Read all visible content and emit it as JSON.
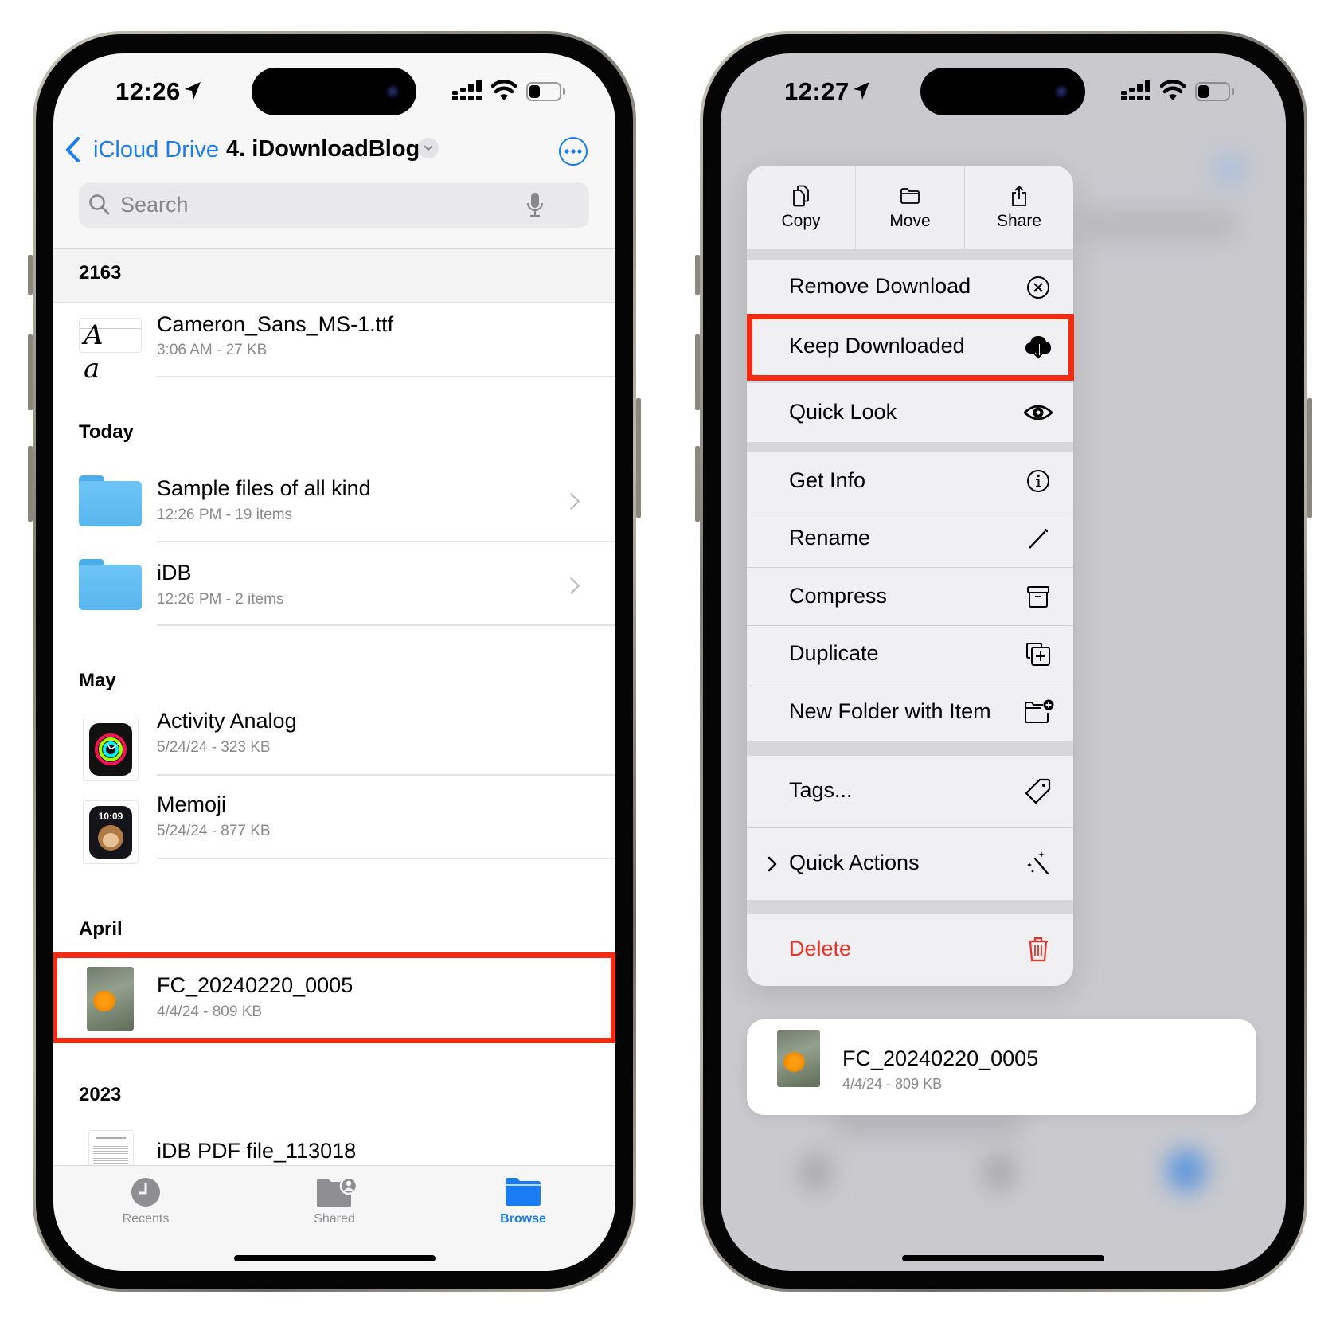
{
  "left_phone": {
    "status_bar": {
      "time": "12:26",
      "battery_level": 0.35
    },
    "nav": {
      "back_label": "iCloud Drive",
      "title": "4. iDownloadBlog"
    },
    "search": {
      "placeholder": "Search"
    },
    "sections": [
      {
        "title": "2163",
        "items": [
          {
            "name": "Cameron_Sans_MS-1.ttf",
            "meta": "3:06 AM - 27 KB",
            "type": "font",
            "thumb_text": "A a"
          }
        ]
      },
      {
        "title": "Today",
        "items": [
          {
            "name": "Sample files of all kind",
            "meta": "12:26 PM - 19 items",
            "type": "folder"
          },
          {
            "name": "iDB",
            "meta": "12:26 PM - 2 items",
            "type": "folder"
          }
        ]
      },
      {
        "title": "May",
        "items": [
          {
            "name": "Activity Analog",
            "meta": "5/24/24 - 323 KB",
            "type": "watchface-activity"
          },
          {
            "name": "Memoji",
            "meta": "5/24/24 - 877 KB",
            "type": "watchface-memoji",
            "thumb_text": "10:09"
          }
        ]
      },
      {
        "title": "April",
        "items": [
          {
            "name": "FC_20240220_0005",
            "meta": "4/4/24 - 809 KB",
            "type": "photo",
            "highlighted": true
          }
        ]
      },
      {
        "title": "2023",
        "items": [
          {
            "name": "iDB PDF file_113018",
            "meta": "",
            "type": "pdf"
          }
        ]
      }
    ],
    "tab_bar": [
      {
        "label": "Recents",
        "icon": "clock-icon",
        "active": false
      },
      {
        "label": "Shared",
        "icon": "shared-folder-icon",
        "active": false
      },
      {
        "label": "Browse",
        "icon": "folder-icon",
        "active": true
      }
    ]
  },
  "right_phone": {
    "status_bar": {
      "time": "12:27",
      "battery_level": 0.35
    },
    "context_menu": {
      "top_actions": [
        {
          "label": "Copy",
          "icon": "copy-icon"
        },
        {
          "label": "Move",
          "icon": "folder-icon"
        },
        {
          "label": "Share",
          "icon": "share-icon"
        }
      ],
      "items": [
        {
          "label": "Remove Download",
          "icon": "xmark-circle-icon",
          "group": 1
        },
        {
          "label": "Keep Downloaded",
          "icon": "cloud-download-icon",
          "group": 1,
          "highlighted": true
        },
        {
          "label": "Quick Look",
          "icon": "eye-icon",
          "group": 2
        },
        {
          "label": "Get Info",
          "icon": "info-circle-icon",
          "group": 3
        },
        {
          "label": "Rename",
          "icon": "pencil-icon",
          "group": 3
        },
        {
          "label": "Compress",
          "icon": "archive-box-icon",
          "group": 3
        },
        {
          "label": "Duplicate",
          "icon": "duplicate-icon",
          "group": 3
        },
        {
          "label": "New Folder with Item",
          "icon": "folder-plus-icon",
          "group": 3
        },
        {
          "label": "Tags...",
          "icon": "tag-icon",
          "group": 4
        },
        {
          "label": "Quick Actions",
          "icon": "magic-wand-icon",
          "group": 4,
          "has_submenu": true
        },
        {
          "label": "Delete",
          "icon": "trash-icon",
          "group": 5,
          "destructive": true
        }
      ]
    },
    "preview": {
      "name": "FC_20240220_0005",
      "meta": "4/4/24 - 809 KB"
    }
  },
  "colors": {
    "accent": "#1a7cf2",
    "highlight": "#f52a12",
    "destructive": "#e8322a",
    "secondary_text": "#8a8a8e"
  }
}
